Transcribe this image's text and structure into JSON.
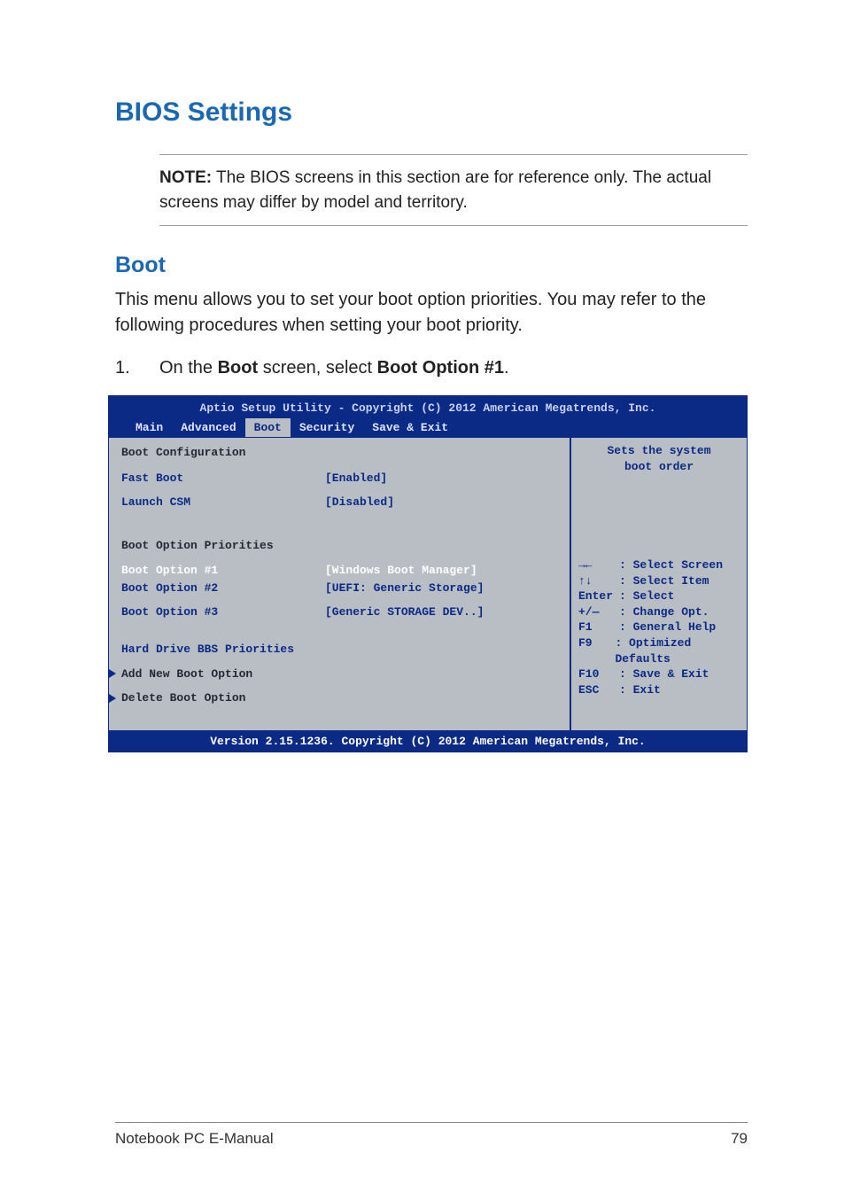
{
  "heading": "BIOS Settings",
  "note": {
    "label": "NOTE:",
    "text": " The BIOS screens in this section are for reference only. The actual screens may differ by model and territory."
  },
  "subheading": "Boot",
  "intro": "This menu allows you to set your boot option priorities. You may refer to the following procedures when setting your boot priority.",
  "step1": {
    "num": "1.",
    "pre": "On the ",
    "bold1": "Boot",
    "mid": " screen, select ",
    "bold2": "Boot Option #1",
    "post": "."
  },
  "bios": {
    "top": "Aptio Setup Utility - Copyright (C) 2012 American Megatrends, Inc.",
    "tabs": [
      "Main",
      "Advanced",
      "Boot",
      "Security",
      "Save & Exit"
    ],
    "active_tab_index": 2,
    "left": {
      "boot_config_title": "Boot Configuration",
      "fast_boot": {
        "label": "Fast Boot",
        "value": "[Enabled]"
      },
      "launch_csm": {
        "label": "Launch CSM",
        "value": "[Disabled]"
      },
      "priorities_title": "Boot Option Priorities",
      "opt1": {
        "label": "Boot Option #1",
        "value": "[Windows Boot Manager]"
      },
      "opt2": {
        "label": "Boot Option #2",
        "value": "[UEFI: Generic Storage]"
      },
      "opt3": {
        "label": "Boot Option #3",
        "value": "[Generic STORAGE DEV..]"
      },
      "hdd_bbs": "Hard Drive BBS Priorities",
      "add_new": "Add New Boot Option",
      "delete_opt": "Delete Boot Option"
    },
    "right": {
      "help_line1": "Sets the system",
      "help_line2": "boot order",
      "hints": [
        {
          "k": "→←  ",
          "v": ": Select Screen"
        },
        {
          "k": "↑↓  ",
          "v": ": Select Item"
        },
        {
          "k": "Enter",
          "v": ": Select"
        },
        {
          "k": "+/— ",
          "v": ": Change Opt."
        },
        {
          "k": "F1  ",
          "v": ": General Help"
        },
        {
          "k": "F9  ",
          "v": ": Optimized Defaults"
        },
        {
          "k": "F10 ",
          "v": ": Save & Exit"
        },
        {
          "k": "ESC ",
          "v": ": Exit"
        }
      ]
    },
    "footer": "Version 2.15.1236. Copyright (C) 2012 American Megatrends, Inc."
  },
  "footer": {
    "left": "Notebook PC E-Manual",
    "right": "79"
  }
}
